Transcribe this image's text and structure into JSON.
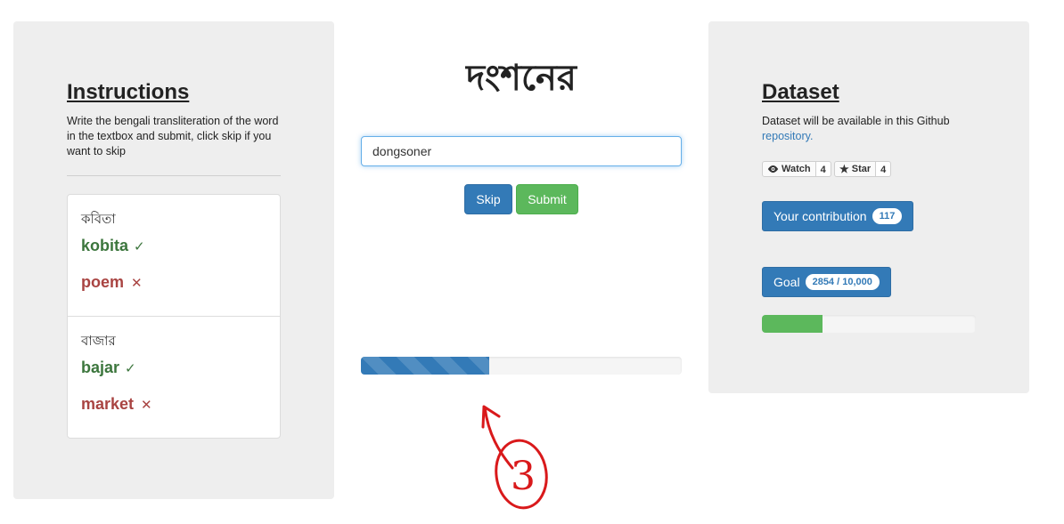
{
  "instructions": {
    "title": "Instructions",
    "text": "Write the bengali transliteration of the word in the textbox and submit, click skip if you want to skip"
  },
  "examples": [
    {
      "bengali": "কবিতা",
      "correct": "kobita",
      "wrong": "poem"
    },
    {
      "bengali": "বাজার",
      "correct": "bajar",
      "wrong": "market"
    }
  ],
  "word": {
    "bengali": "দংশনের"
  },
  "input": {
    "value": "dongsoner"
  },
  "buttons": {
    "skip": "Skip",
    "submit": "Submit"
  },
  "progress": {
    "fraction": 0.4
  },
  "annotation": {
    "label": "3"
  },
  "dataset": {
    "title": "Dataset",
    "text": "Dataset will be available in this Github",
    "link": "repository."
  },
  "github": {
    "watch_label": "Watch",
    "watch_count": "4",
    "star_label": "Star",
    "star_count": "4"
  },
  "contribution": {
    "label": "Your contribution",
    "count": "117"
  },
  "goal": {
    "label": "Goal",
    "value": "2854 / 10,000",
    "fraction": 0.2854
  },
  "colors": {
    "primary": "#337ab7",
    "success": "#5cb85c",
    "correct": "#3c763d",
    "wrong": "#a94442"
  }
}
